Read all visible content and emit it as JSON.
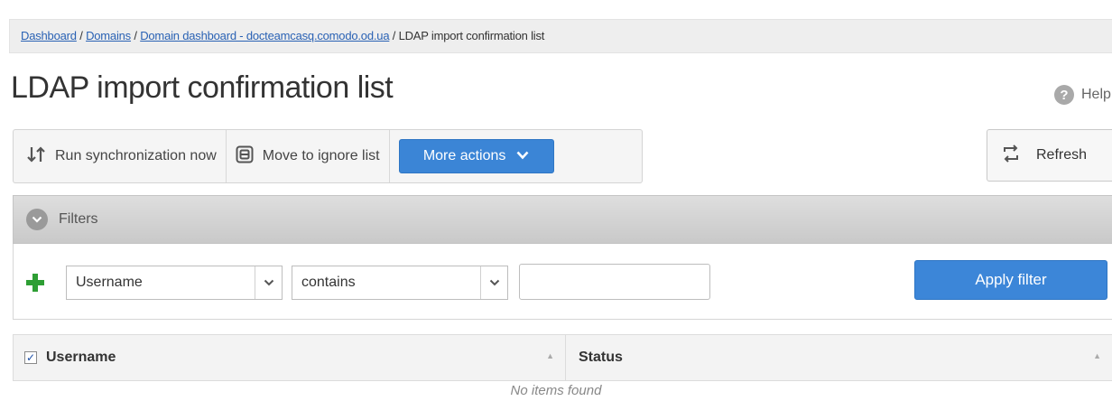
{
  "breadcrumb": {
    "items": [
      "Dashboard",
      "Domains",
      "Domain dashboard - docteamcasq.comodo.od.ua"
    ],
    "current": "LDAP import confirmation list"
  },
  "page": {
    "title": "LDAP import confirmation list"
  },
  "help": {
    "label": "Help",
    "icon": "question-icon"
  },
  "toolbar": {
    "run_sync_label": "Run synchronization now",
    "run_sync_icon": "sort-arrows-icon",
    "move_ignore_label": "Move to ignore list",
    "move_ignore_icon": "ignore-icon",
    "more_actions_label": "More actions",
    "refresh_label": "Refresh",
    "refresh_icon": "refresh-icon"
  },
  "filters": {
    "title": "Filters",
    "field_value": "Username",
    "operator_value": "contains",
    "text_value": "",
    "apply_label": "Apply filter"
  },
  "table": {
    "columns": [
      "Username",
      "Status"
    ],
    "select_all_checked": true,
    "empty_text": "No items found"
  },
  "colors": {
    "accent": "#3b85d6",
    "link": "#2a62b4",
    "add": "#2e9e34"
  }
}
